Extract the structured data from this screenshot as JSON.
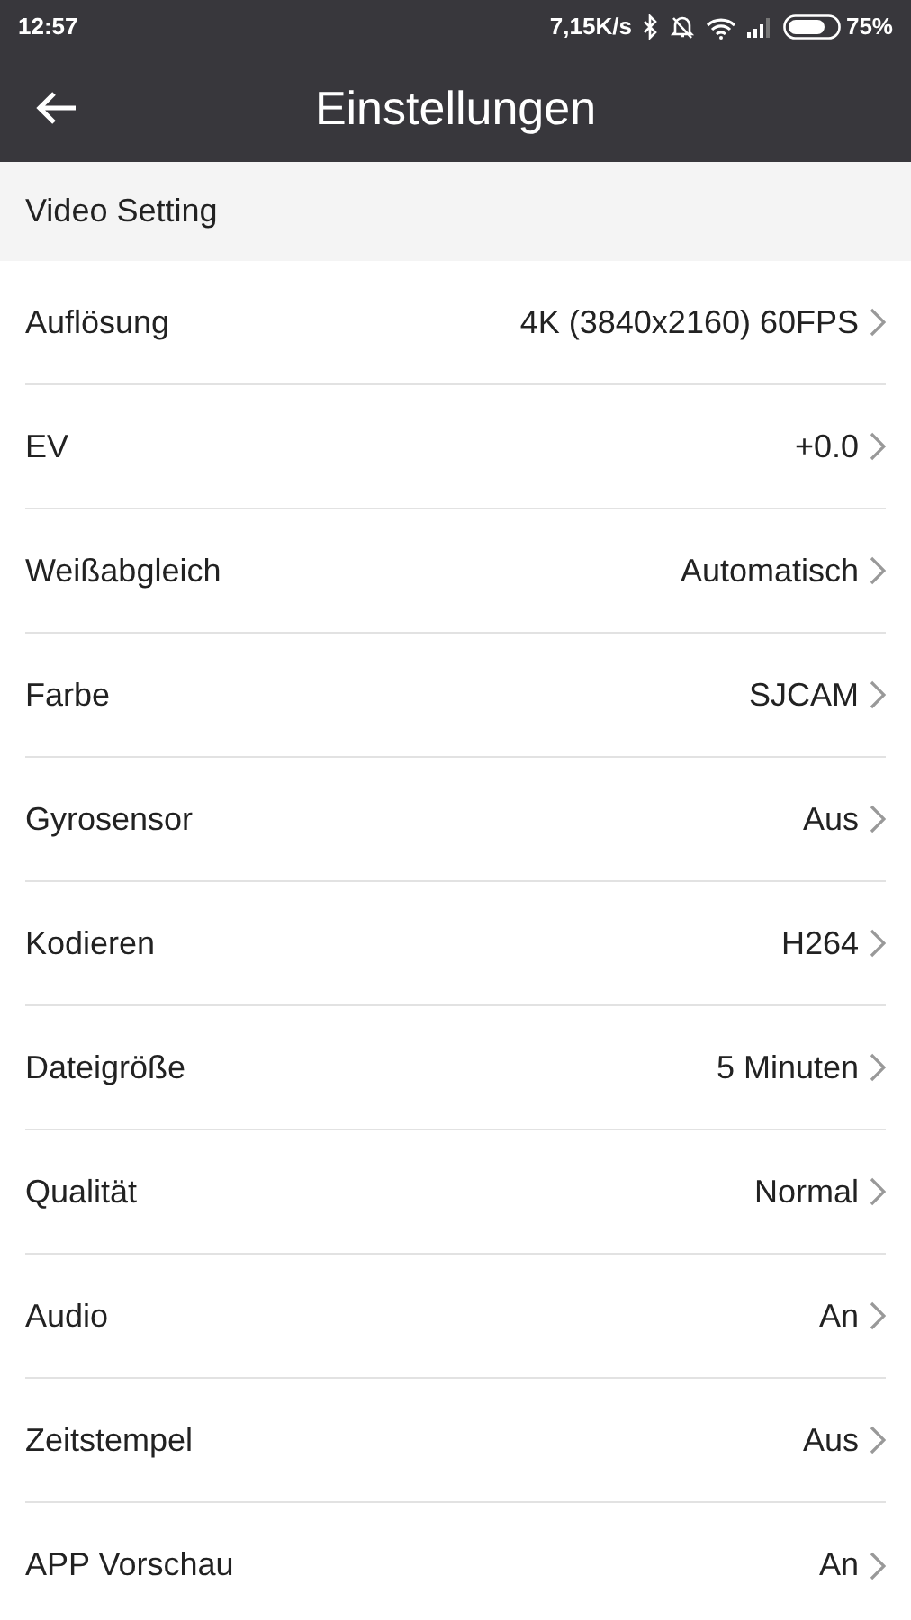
{
  "status_bar": {
    "time": "12:57",
    "network_speed": "7,15K/s",
    "battery": "75%"
  },
  "toolbar": {
    "title": "Einstellungen"
  },
  "section": {
    "title": "Video Setting"
  },
  "settings": [
    {
      "label": "Auflösung",
      "value": "4K (3840x2160) 60FPS"
    },
    {
      "label": "EV",
      "value": "+0.0"
    },
    {
      "label": "Weißabgleich",
      "value": "Automatisch"
    },
    {
      "label": "Farbe",
      "value": "SJCAM"
    },
    {
      "label": "Gyrosensor",
      "value": "Aus"
    },
    {
      "label": "Kodieren",
      "value": "H264"
    },
    {
      "label": "Dateigröße",
      "value": "5 Minuten"
    },
    {
      "label": "Qualität",
      "value": "Normal"
    },
    {
      "label": "Audio",
      "value": "An"
    },
    {
      "label": "Zeitstempel",
      "value": "Aus"
    },
    {
      "label": "APP Vorschau",
      "value": "An"
    }
  ]
}
